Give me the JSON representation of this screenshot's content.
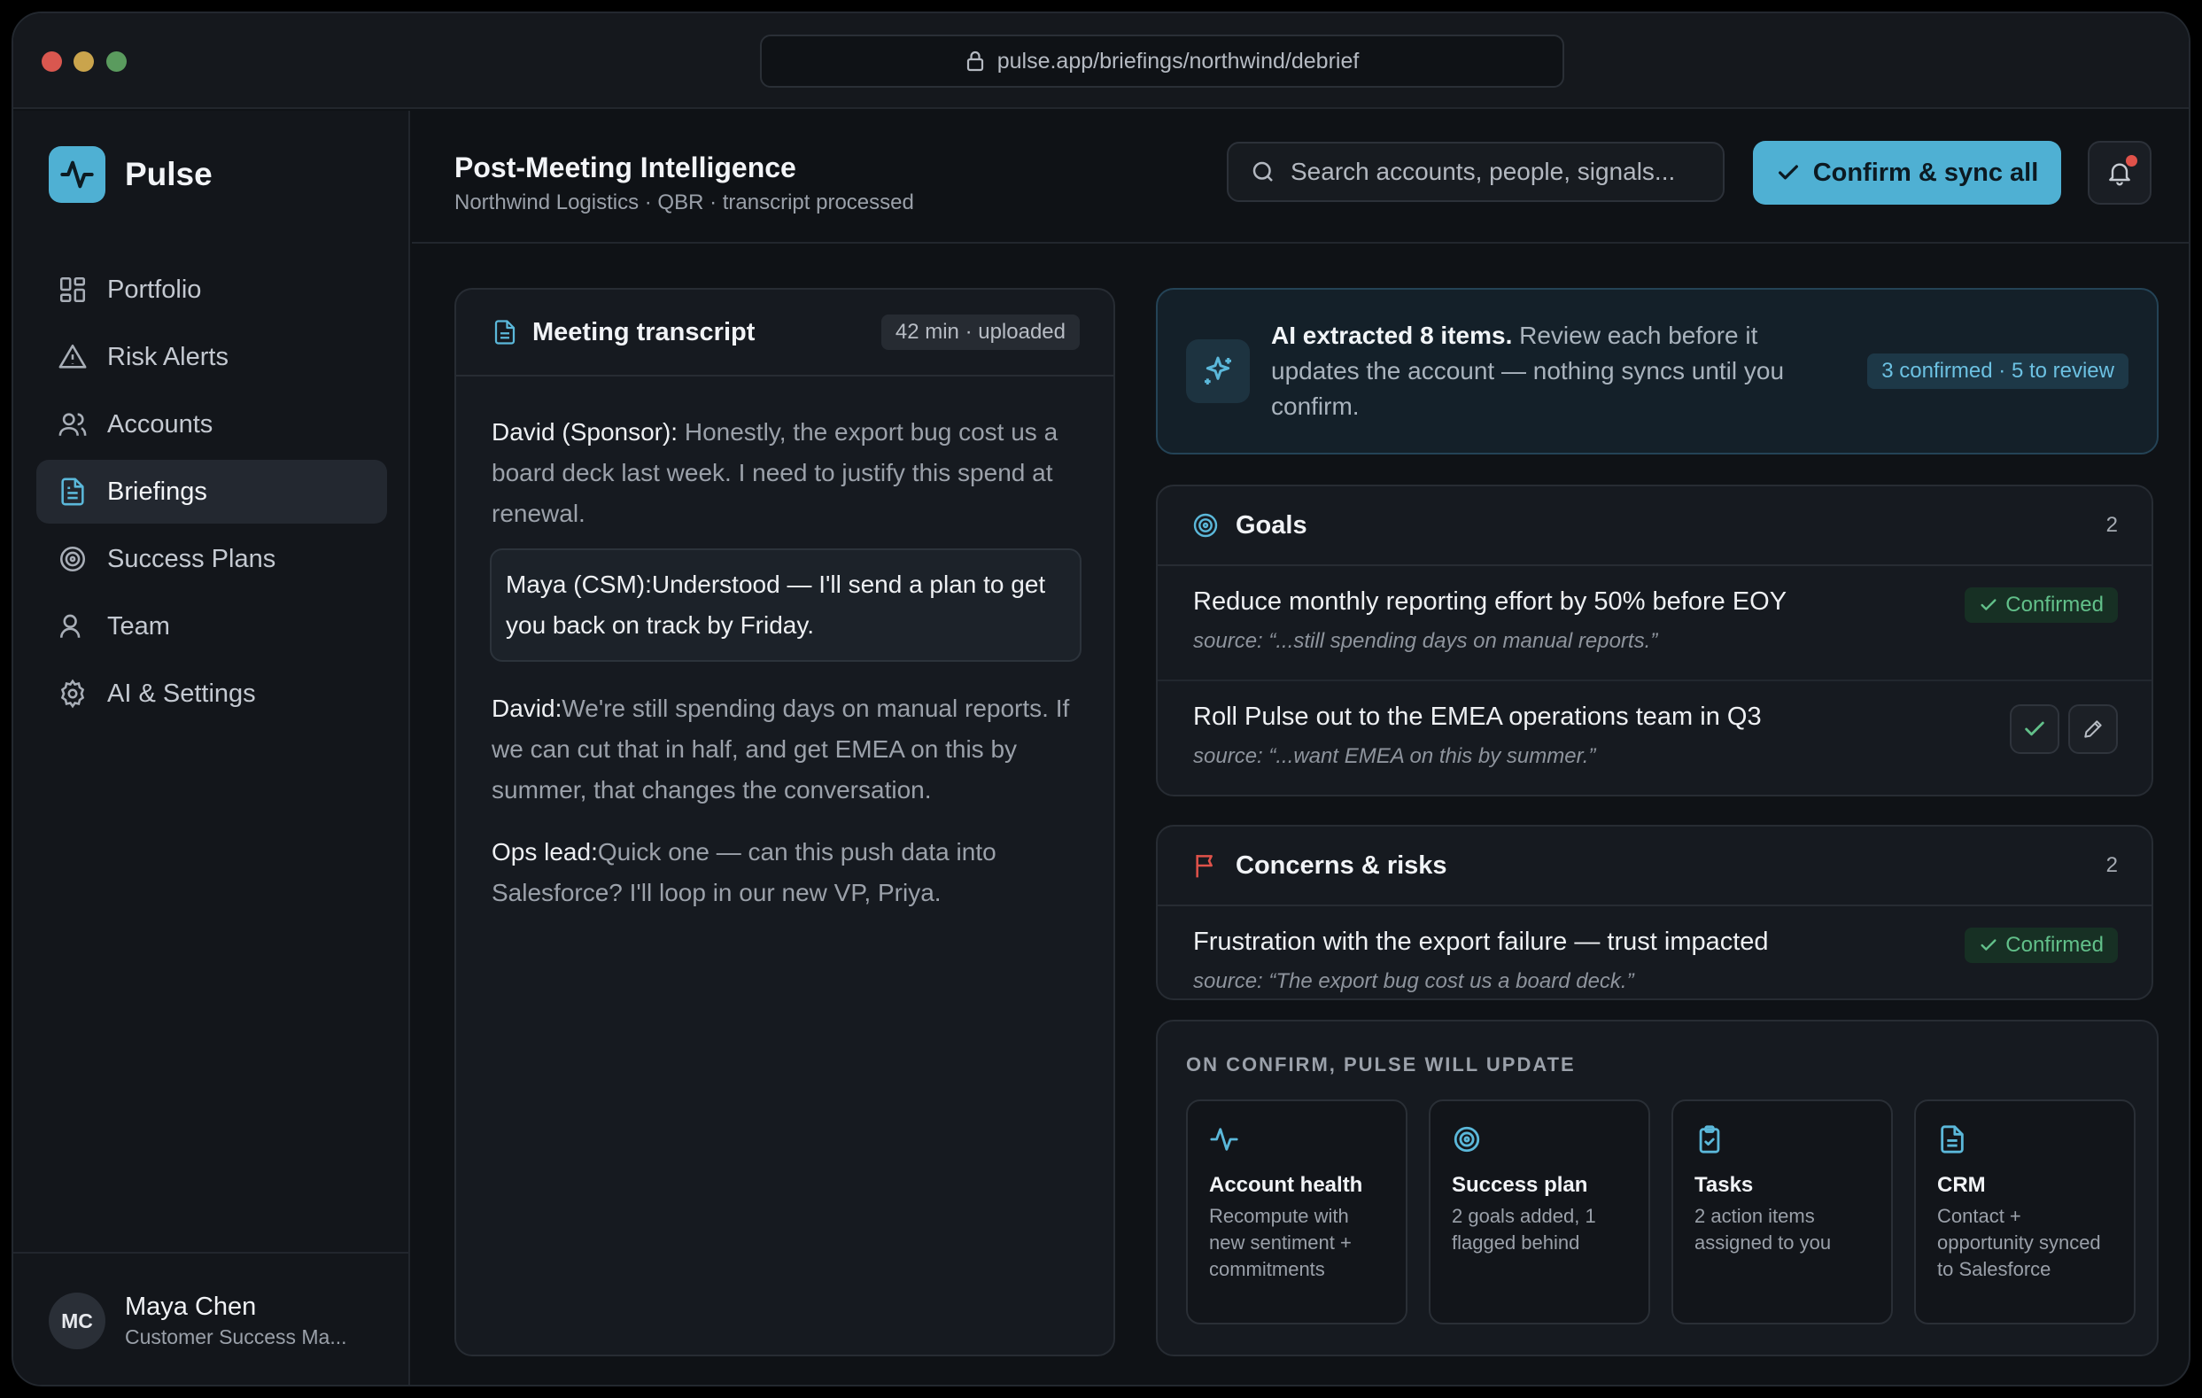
{
  "browser": {
    "url": "pulse.app/briefings/northwind/debrief"
  },
  "brand": {
    "name": "Pulse"
  },
  "sidebar": {
    "items": [
      {
        "label": "Portfolio",
        "icon": "grid-icon"
      },
      {
        "label": "Risk Alerts",
        "icon": "warning-icon"
      },
      {
        "label": "Accounts",
        "icon": "users-icon"
      },
      {
        "label": "Briefings",
        "icon": "document-icon",
        "active": true
      },
      {
        "label": "Success Plans",
        "icon": "target-icon"
      },
      {
        "label": "Team",
        "icon": "user-icon"
      },
      {
        "label": "AI & Settings",
        "icon": "gear-icon"
      }
    ]
  },
  "user": {
    "initials": "MC",
    "name": "Maya Chen",
    "role": "Customer Success Ma..."
  },
  "header": {
    "title": "Post-Meeting Intelligence",
    "subtitle": "Northwind Logistics · QBR · transcript processed",
    "search_placeholder": "Search accounts, people, signals...",
    "confirm_label": "Confirm & sync all"
  },
  "transcript": {
    "title": "Meeting transcript",
    "meta": "42 min · uploaded",
    "lines": [
      {
        "speaker": "David (Sponsor):",
        "text": " Honestly, the export bug cost us a board deck last week. I need to justify this spend at renewal."
      },
      {
        "speaker": "Maya (CSM):",
        "text": "Understood — I'll send a plan to get you back on track by Friday."
      },
      {
        "speaker": "David:",
        "text": "We're still spending days on manual reports. If we can cut that in half, and get EMEA on this by summer, that changes the conversation."
      },
      {
        "speaker": "Ops lead:",
        "text": "Quick one — can this push data into Salesforce? I'll loop in our new VP, Priya."
      }
    ]
  },
  "ai_banner": {
    "lead": "AI extracted 8 items.",
    "text": " Review each before it updates the account — nothing syncs until you confirm.",
    "status": "3 confirmed · 5 to review"
  },
  "goals": {
    "title": "Goals",
    "count": "2",
    "items": [
      {
        "title": "Reduce monthly reporting effort by 50% before EOY",
        "source": "source: “...still spending days on manual reports.”",
        "status": "Confirmed"
      },
      {
        "title": "Roll Pulse out to the EMEA operations team in Q3",
        "source": "source: “...want EMEA on this by summer.”"
      }
    ]
  },
  "concerns": {
    "title": "Concerns & risks",
    "count": "2",
    "items": [
      {
        "title": "Frustration with the export failure — trust impacted",
        "source": "source: “The export bug cost us a board deck.”",
        "status": "Confirmed"
      }
    ]
  },
  "updates": {
    "label": "ON CONFIRM, PULSE WILL UPDATE",
    "tiles": [
      {
        "title": "Account health",
        "desc": "Recompute with new sentiment + commitments",
        "icon": "pulse-icon"
      },
      {
        "title": "Success plan",
        "desc": "2 goals added, 1 flagged behind",
        "icon": "target-icon"
      },
      {
        "title": "Tasks",
        "desc": "2 action items assigned to you",
        "icon": "clipboard-icon"
      },
      {
        "title": "CRM",
        "desc": "Contact + opportunity synced to Salesforce",
        "icon": "document-icon"
      }
    ]
  },
  "colors": {
    "accent": "#4fb0d3",
    "success": "#62c08a",
    "danger": "#e0524a"
  }
}
